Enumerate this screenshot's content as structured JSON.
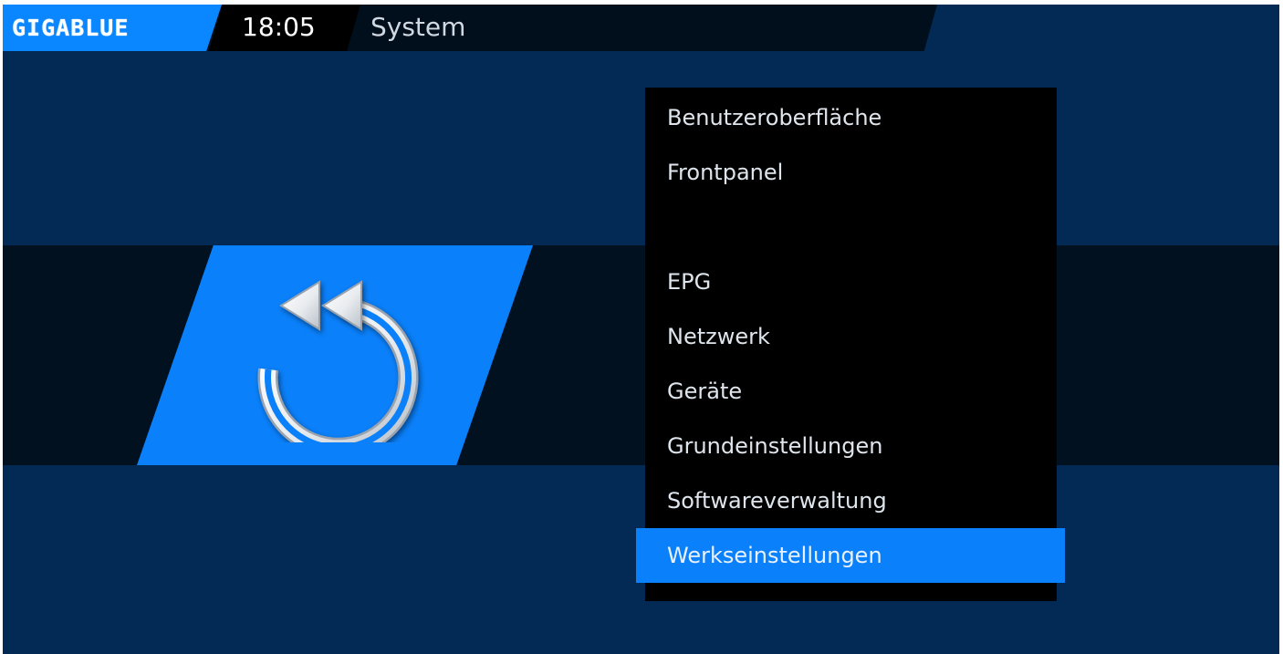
{
  "header": {
    "logo": "GIGABLUE",
    "clock": "18:05",
    "title": "System"
  },
  "icon": {
    "name": "factory-reset-icon"
  },
  "menu": {
    "items": [
      {
        "label": "Benutzeroberfläche",
        "selected": false
      },
      {
        "label": "Frontpanel",
        "selected": false
      },
      {
        "label": "",
        "selected": false
      },
      {
        "label": "EPG",
        "selected": false
      },
      {
        "label": "Netzwerk",
        "selected": false
      },
      {
        "label": "Geräte",
        "selected": false
      },
      {
        "label": "Grundeinstellungen",
        "selected": false
      },
      {
        "label": "Softwareverwaltung",
        "selected": false
      },
      {
        "label": "Werkseinstellungen",
        "selected": true
      }
    ]
  },
  "colors": {
    "background": "#022a54",
    "band": "#011120",
    "accent": "#0a80fa",
    "menu_bg": "#000000",
    "header_bg": "#010e1c"
  }
}
